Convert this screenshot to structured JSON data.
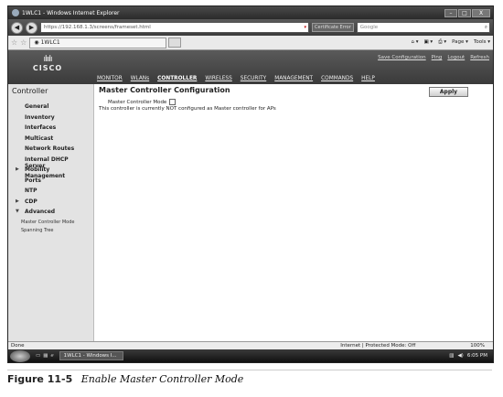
{
  "window": {
    "title": "1WLC1 - Windows Internet Explorer",
    "buttons": [
      "–",
      "□",
      "X"
    ]
  },
  "address_bar": {
    "url": "https://192.168.1.3/screens/frameset.html",
    "cert_label": "Certificate Error",
    "search_placeholder": "Google"
  },
  "tab_bar": {
    "tab_label": "1WLC1",
    "page_label": "Page ▾",
    "tools_label": "Tools ▾"
  },
  "cisco_header": {
    "logo_word": "CISCO",
    "top_links": [
      "Save Configuration",
      "Ping",
      "Logout",
      "Refresh"
    ],
    "menu": [
      "MONITOR",
      "WLANs",
      "CONTROLLER",
      "WIRELESS",
      "SECURITY",
      "MANAGEMENT",
      "COMMANDS",
      "HELP"
    ],
    "active_menu": "CONTROLLER"
  },
  "sidebar": {
    "title": "Controller",
    "items": [
      {
        "label": "General",
        "arrow": ""
      },
      {
        "label": "Inventory",
        "arrow": ""
      },
      {
        "label": "Interfaces",
        "arrow": ""
      },
      {
        "label": "Multicast",
        "arrow": ""
      },
      {
        "label": "Network Routes",
        "arrow": ""
      },
      {
        "label": "Internal DHCP Server",
        "arrow": ""
      },
      {
        "label": "Mobility Management",
        "arrow": "▶"
      },
      {
        "label": "Ports",
        "arrow": ""
      },
      {
        "label": "NTP",
        "arrow": ""
      },
      {
        "label": "CDP",
        "arrow": "▶"
      },
      {
        "label": "Advanced",
        "arrow": "▼"
      }
    ],
    "sub_items": [
      "Master Controller Mode",
      "Spanning Tree"
    ]
  },
  "main": {
    "title": "Master Controller Configuration",
    "apply_label": "Apply",
    "checkbox_label": "Master Controller Mode",
    "note": "This controller is currently NOT configured as Master controller for APs"
  },
  "status_bar": {
    "left": "Done",
    "zone": "Internet | Protected Mode: Off",
    "zoom": "100%"
  },
  "taskbar": {
    "task_label": "1WLC1 - Windows I...",
    "clock": "6:05 PM"
  },
  "caption": {
    "figure": "Figure 11-5",
    "text": "Enable Master Controller Mode"
  }
}
